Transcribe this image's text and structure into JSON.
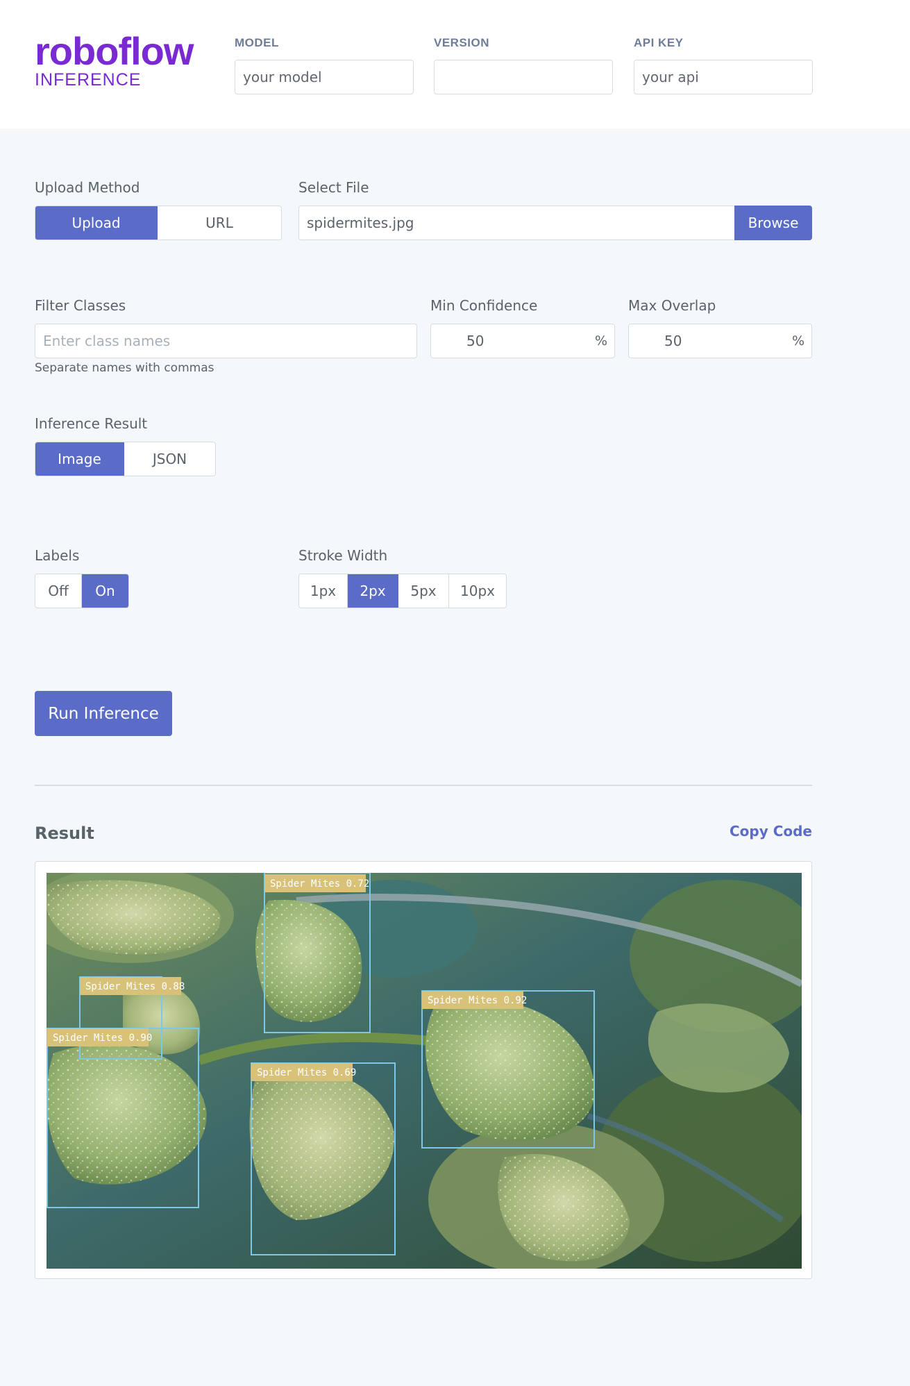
{
  "brand": {
    "name": "roboflow",
    "sub": "INFERENCE",
    "color": "#7a2ad1"
  },
  "header": {
    "model": {
      "label": "MODEL",
      "value": "your model"
    },
    "version": {
      "label": "VERSION",
      "value": ""
    },
    "api_key": {
      "label": "API KEY",
      "value": "your api"
    }
  },
  "upload": {
    "method_label": "Upload Method",
    "options": [
      "Upload",
      "URL"
    ],
    "selected": "Upload",
    "file_label": "Select File",
    "file_value": "spidermites.jpg",
    "browse_label": "Browse"
  },
  "filter": {
    "label": "Filter Classes",
    "placeholder": "Enter class names",
    "help": "Separate names with commas"
  },
  "min_confidence": {
    "label": "Min Confidence",
    "value": "50",
    "unit": "%"
  },
  "max_overlap": {
    "label": "Max Overlap",
    "value": "50",
    "unit": "%"
  },
  "inference_result": {
    "label": "Inference Result",
    "options": [
      "Image",
      "JSON"
    ],
    "selected": "Image"
  },
  "labels": {
    "label": "Labels",
    "options": [
      "Off",
      "On"
    ],
    "selected": "On"
  },
  "stroke": {
    "label": "Stroke Width",
    "options": [
      "1px",
      "2px",
      "5px",
      "10px"
    ],
    "selected": "2px"
  },
  "run_button": "Run Inference",
  "result": {
    "title": "Result",
    "copy_code": "Copy Code",
    "detections": [
      {
        "label": "Spider Mites 0.72"
      },
      {
        "label": "Spider Mites 0.88"
      },
      {
        "label": "Spider Mites 0.90"
      },
      {
        "label": "Spider Mites 0.92"
      },
      {
        "label": "Spider Mites 0.69"
      }
    ]
  },
  "colors": {
    "accent": "#5b6bc8",
    "box_stroke": "#7fc7e6",
    "label_bg": "#d8c27a"
  }
}
